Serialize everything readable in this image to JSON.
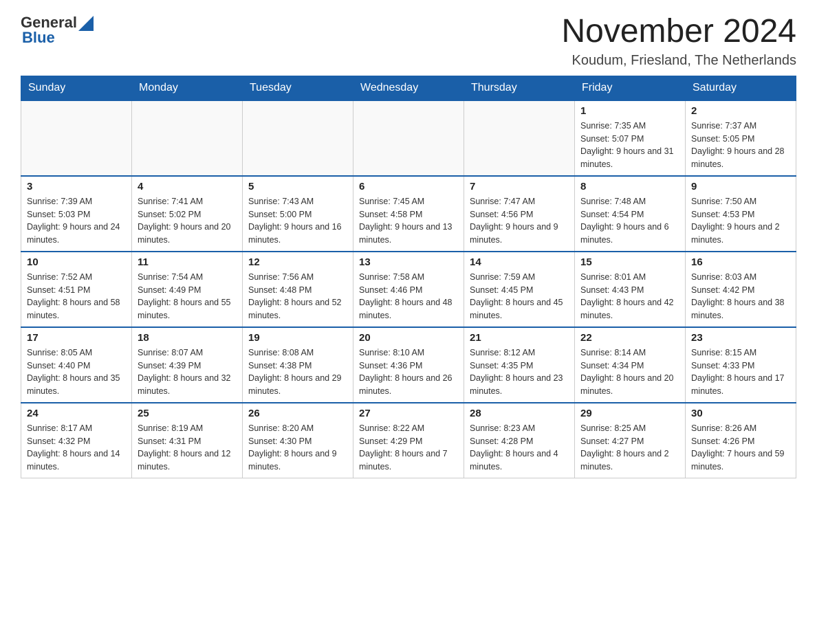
{
  "logo": {
    "general": "General",
    "blue": "Blue"
  },
  "title": "November 2024",
  "subtitle": "Koudum, Friesland, The Netherlands",
  "days_of_week": [
    "Sunday",
    "Monday",
    "Tuesday",
    "Wednesday",
    "Thursday",
    "Friday",
    "Saturday"
  ],
  "weeks": [
    [
      {
        "day": "",
        "info": ""
      },
      {
        "day": "",
        "info": ""
      },
      {
        "day": "",
        "info": ""
      },
      {
        "day": "",
        "info": ""
      },
      {
        "day": "",
        "info": ""
      },
      {
        "day": "1",
        "info": "Sunrise: 7:35 AM\nSunset: 5:07 PM\nDaylight: 9 hours and 31 minutes."
      },
      {
        "day": "2",
        "info": "Sunrise: 7:37 AM\nSunset: 5:05 PM\nDaylight: 9 hours and 28 minutes."
      }
    ],
    [
      {
        "day": "3",
        "info": "Sunrise: 7:39 AM\nSunset: 5:03 PM\nDaylight: 9 hours and 24 minutes."
      },
      {
        "day": "4",
        "info": "Sunrise: 7:41 AM\nSunset: 5:02 PM\nDaylight: 9 hours and 20 minutes."
      },
      {
        "day": "5",
        "info": "Sunrise: 7:43 AM\nSunset: 5:00 PM\nDaylight: 9 hours and 16 minutes."
      },
      {
        "day": "6",
        "info": "Sunrise: 7:45 AM\nSunset: 4:58 PM\nDaylight: 9 hours and 13 minutes."
      },
      {
        "day": "7",
        "info": "Sunrise: 7:47 AM\nSunset: 4:56 PM\nDaylight: 9 hours and 9 minutes."
      },
      {
        "day": "8",
        "info": "Sunrise: 7:48 AM\nSunset: 4:54 PM\nDaylight: 9 hours and 6 minutes."
      },
      {
        "day": "9",
        "info": "Sunrise: 7:50 AM\nSunset: 4:53 PM\nDaylight: 9 hours and 2 minutes."
      }
    ],
    [
      {
        "day": "10",
        "info": "Sunrise: 7:52 AM\nSunset: 4:51 PM\nDaylight: 8 hours and 58 minutes."
      },
      {
        "day": "11",
        "info": "Sunrise: 7:54 AM\nSunset: 4:49 PM\nDaylight: 8 hours and 55 minutes."
      },
      {
        "day": "12",
        "info": "Sunrise: 7:56 AM\nSunset: 4:48 PM\nDaylight: 8 hours and 52 minutes."
      },
      {
        "day": "13",
        "info": "Sunrise: 7:58 AM\nSunset: 4:46 PM\nDaylight: 8 hours and 48 minutes."
      },
      {
        "day": "14",
        "info": "Sunrise: 7:59 AM\nSunset: 4:45 PM\nDaylight: 8 hours and 45 minutes."
      },
      {
        "day": "15",
        "info": "Sunrise: 8:01 AM\nSunset: 4:43 PM\nDaylight: 8 hours and 42 minutes."
      },
      {
        "day": "16",
        "info": "Sunrise: 8:03 AM\nSunset: 4:42 PM\nDaylight: 8 hours and 38 minutes."
      }
    ],
    [
      {
        "day": "17",
        "info": "Sunrise: 8:05 AM\nSunset: 4:40 PM\nDaylight: 8 hours and 35 minutes."
      },
      {
        "day": "18",
        "info": "Sunrise: 8:07 AM\nSunset: 4:39 PM\nDaylight: 8 hours and 32 minutes."
      },
      {
        "day": "19",
        "info": "Sunrise: 8:08 AM\nSunset: 4:38 PM\nDaylight: 8 hours and 29 minutes."
      },
      {
        "day": "20",
        "info": "Sunrise: 8:10 AM\nSunset: 4:36 PM\nDaylight: 8 hours and 26 minutes."
      },
      {
        "day": "21",
        "info": "Sunrise: 8:12 AM\nSunset: 4:35 PM\nDaylight: 8 hours and 23 minutes."
      },
      {
        "day": "22",
        "info": "Sunrise: 8:14 AM\nSunset: 4:34 PM\nDaylight: 8 hours and 20 minutes."
      },
      {
        "day": "23",
        "info": "Sunrise: 8:15 AM\nSunset: 4:33 PM\nDaylight: 8 hours and 17 minutes."
      }
    ],
    [
      {
        "day": "24",
        "info": "Sunrise: 8:17 AM\nSunset: 4:32 PM\nDaylight: 8 hours and 14 minutes."
      },
      {
        "day": "25",
        "info": "Sunrise: 8:19 AM\nSunset: 4:31 PM\nDaylight: 8 hours and 12 minutes."
      },
      {
        "day": "26",
        "info": "Sunrise: 8:20 AM\nSunset: 4:30 PM\nDaylight: 8 hours and 9 minutes."
      },
      {
        "day": "27",
        "info": "Sunrise: 8:22 AM\nSunset: 4:29 PM\nDaylight: 8 hours and 7 minutes."
      },
      {
        "day": "28",
        "info": "Sunrise: 8:23 AM\nSunset: 4:28 PM\nDaylight: 8 hours and 4 minutes."
      },
      {
        "day": "29",
        "info": "Sunrise: 8:25 AM\nSunset: 4:27 PM\nDaylight: 8 hours and 2 minutes."
      },
      {
        "day": "30",
        "info": "Sunrise: 8:26 AM\nSunset: 4:26 PM\nDaylight: 7 hours and 59 minutes."
      }
    ]
  ]
}
